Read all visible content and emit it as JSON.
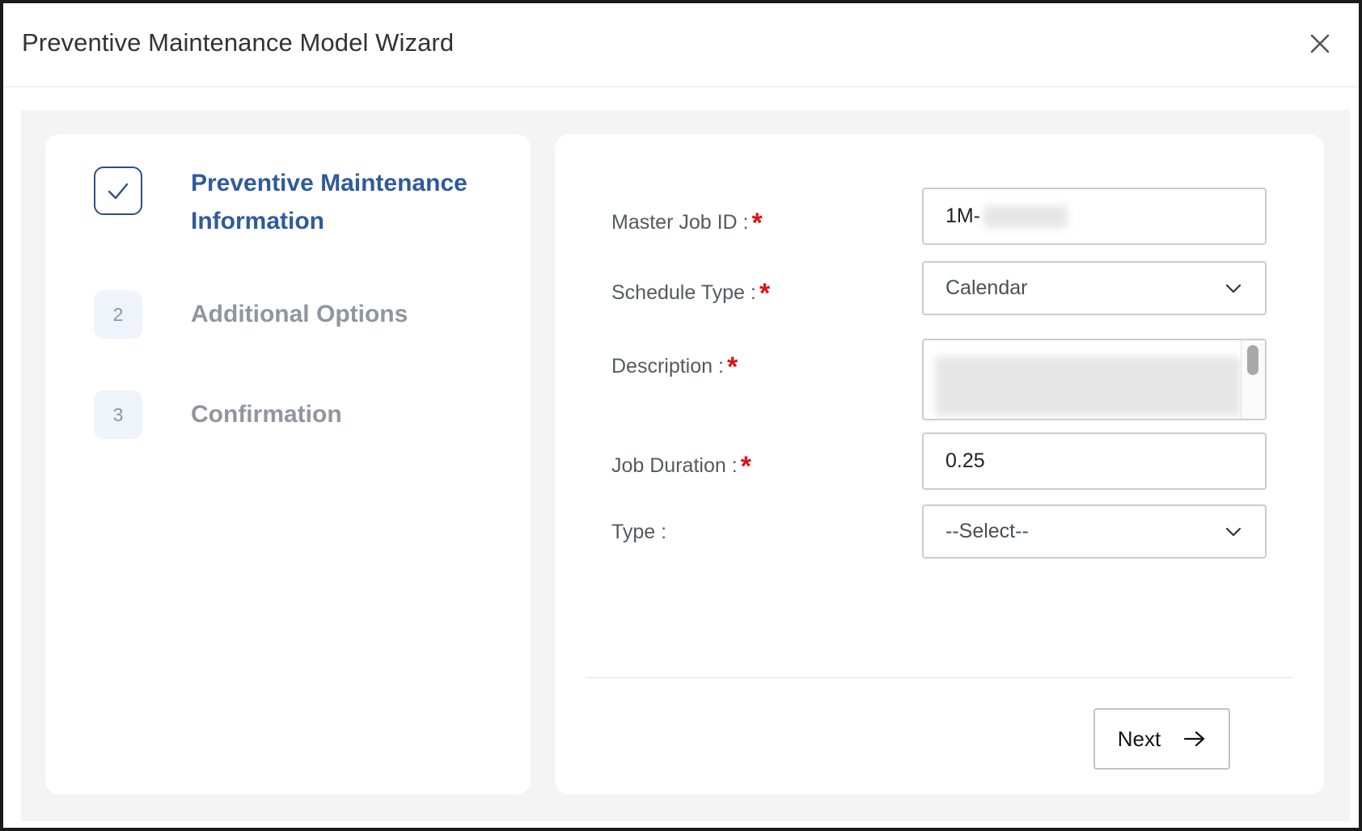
{
  "dialog": {
    "title": "Preventive Maintenance Model Wizard",
    "close_icon": "close-icon"
  },
  "steps": [
    {
      "number": "",
      "label": "Preventive Maintenance Information",
      "status": "completed",
      "icon": "checkmark-icon"
    },
    {
      "number": "2",
      "label": "Additional Options",
      "status": "pending"
    },
    {
      "number": "3",
      "label": "Confirmation",
      "status": "pending"
    }
  ],
  "form": {
    "master_job_id": {
      "label": "Master Job ID :",
      "value": "1M-",
      "required": "*"
    },
    "schedule_type": {
      "label": "Schedule Type :",
      "value": "Calendar",
      "required": "*"
    },
    "description": {
      "label": "Description :",
      "value": "",
      "required": "*"
    },
    "job_duration": {
      "label": "Job Duration :",
      "value": "0.25",
      "required": "*"
    },
    "type": {
      "label": "Type :",
      "value": "--Select--"
    }
  },
  "actions": {
    "next_label": "Next",
    "next_icon": "arrow-right-icon"
  },
  "colors": {
    "accent": "#2f5b9c",
    "required": "#e01010",
    "inactive_step": "#8f969e",
    "panel_bg": "#f4f4f4"
  }
}
